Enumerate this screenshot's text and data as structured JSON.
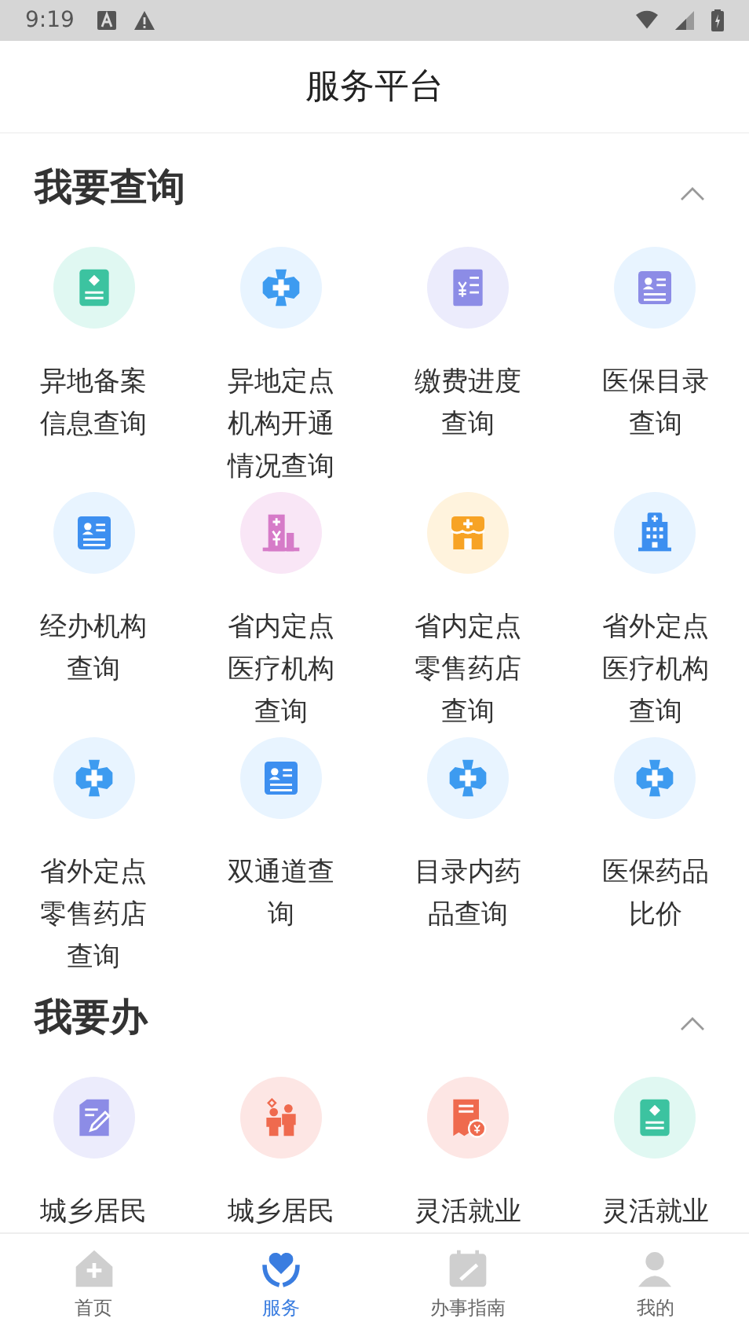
{
  "status_bar": {
    "time": "9:19"
  },
  "header": {
    "title": "服务平台"
  },
  "sections": [
    {
      "title": "我要查询",
      "expanded": true,
      "items": [
        {
          "label": "异地备案信息查询",
          "kind": "record",
          "color": "#3cc3a0"
        },
        {
          "label": "异地定点机构开通情况查询",
          "kind": "cross",
          "color": "#3d9bf0"
        },
        {
          "label": "缴费进度查询",
          "kind": "bill",
          "color": "#8c8ce6"
        },
        {
          "label": "医保目录查询",
          "kind": "card",
          "color": "#8c8ce6"
        },
        {
          "label": "经办机构查询",
          "kind": "card",
          "color": "#3d8ff0"
        },
        {
          "label": "省内定点医疗机构查询",
          "kind": "building",
          "color": "#d67bc8"
        },
        {
          "label": "省内定点零售药店查询",
          "kind": "shop",
          "color": "#f7a325"
        },
        {
          "label": "省外定点医疗机构查询",
          "kind": "hospital",
          "color": "#3d8ff0"
        },
        {
          "label": "省外定点零售药店查询",
          "kind": "cross",
          "color": "#3d9bf0"
        },
        {
          "label": "双通道查询",
          "kind": "card",
          "color": "#3d8ff0"
        },
        {
          "label": "目录内药品查询",
          "kind": "cross",
          "color": "#3d9bf0"
        },
        {
          "label": "医保药品比价",
          "kind": "cross",
          "color": "#3d9bf0"
        }
      ]
    },
    {
      "title": "我要办",
      "expanded": true,
      "items": [
        {
          "label": "城乡居民",
          "kind": "pen",
          "color": "#8c8ce6"
        },
        {
          "label": "城乡居民",
          "kind": "people",
          "color": "#ef6a4e"
        },
        {
          "label": "灵活就业",
          "kind": "receipt",
          "color": "#ef6a4e"
        },
        {
          "label": "灵活就业",
          "kind": "record",
          "color": "#3cc3a0"
        }
      ]
    }
  ],
  "nav": [
    {
      "label": "首页",
      "kind": "home",
      "selected": false
    },
    {
      "label": "服务",
      "kind": "heart",
      "selected": true
    },
    {
      "label": "办事指南",
      "kind": "calendar",
      "selected": false
    },
    {
      "label": "我的",
      "kind": "person",
      "selected": false
    }
  ]
}
